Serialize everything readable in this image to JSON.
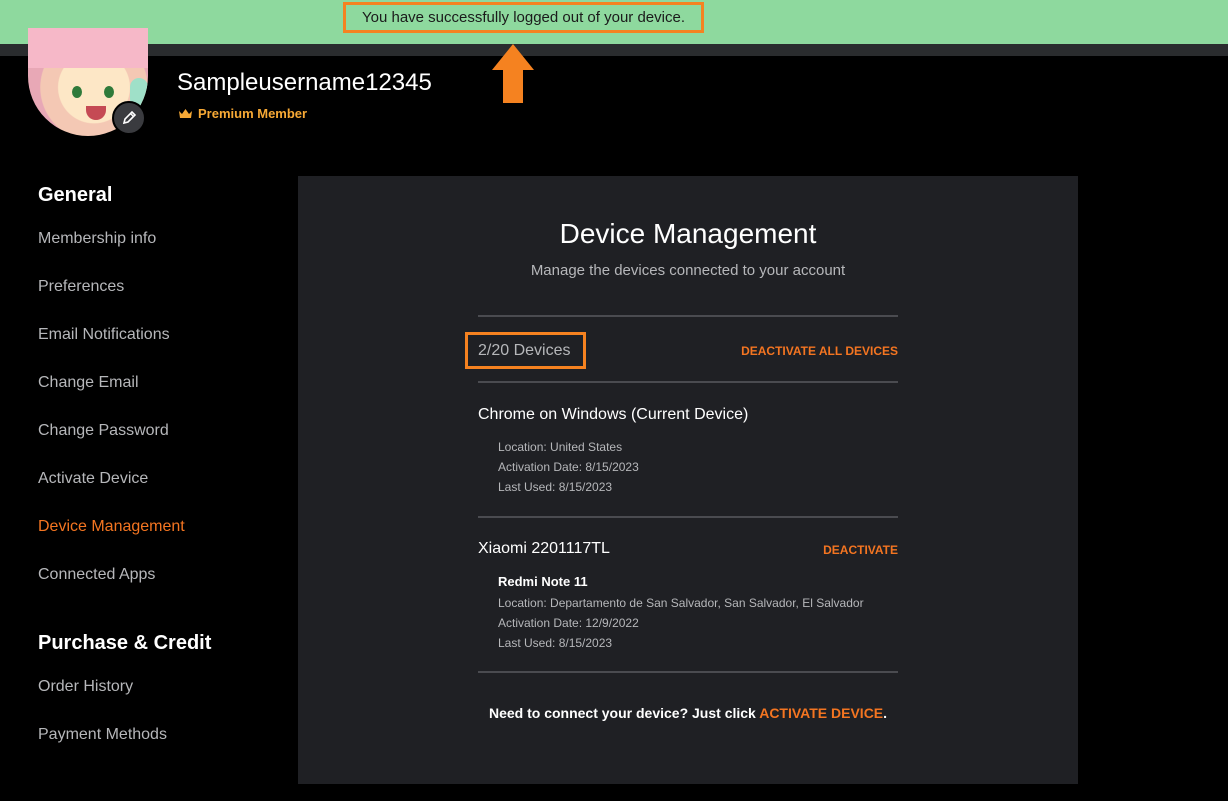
{
  "banner": {
    "message": "You have successfully logged out of your device."
  },
  "profile": {
    "username": "Sampleusername12345",
    "badge": "Premium Member"
  },
  "sidebar": {
    "sections": [
      {
        "title": "General",
        "items": [
          "Membership info",
          "Preferences",
          "Email Notifications",
          "Change Email",
          "Change Password",
          "Activate Device",
          "Device Management",
          "Connected Apps"
        ]
      },
      {
        "title": "Purchase & Credit",
        "items": [
          "Order History",
          "Payment Methods"
        ]
      }
    ],
    "active_item": "Device Management"
  },
  "main": {
    "title": "Device Management",
    "subtitle": "Manage the devices connected to your account",
    "device_count": "2/20 Devices",
    "deactivate_all": "DEACTIVATE ALL DEVICES",
    "devices": [
      {
        "name": "Chrome on Windows (Current Device)",
        "location": "Location: United States",
        "activation": "Activation Date: 8/15/2023",
        "last_used": "Last Used: 8/15/2023"
      },
      {
        "name": "Xiaomi 2201117TL",
        "model": "Redmi Note 11",
        "location": "Location: Departamento de San Salvador, San Salvador, El Salvador",
        "activation": "Activation Date: 12/9/2022",
        "last_used": "Last Used: 8/15/2023",
        "action": "DEACTIVATE"
      }
    ],
    "footer_text": "Need to connect your device? Just click ",
    "footer_link": "ACTIVATE DEVICE",
    "footer_end": "."
  },
  "colors": {
    "accent": "#f47521",
    "banner": "#8ed99e",
    "highlight": "#f58220",
    "panel": "#1f2024"
  }
}
